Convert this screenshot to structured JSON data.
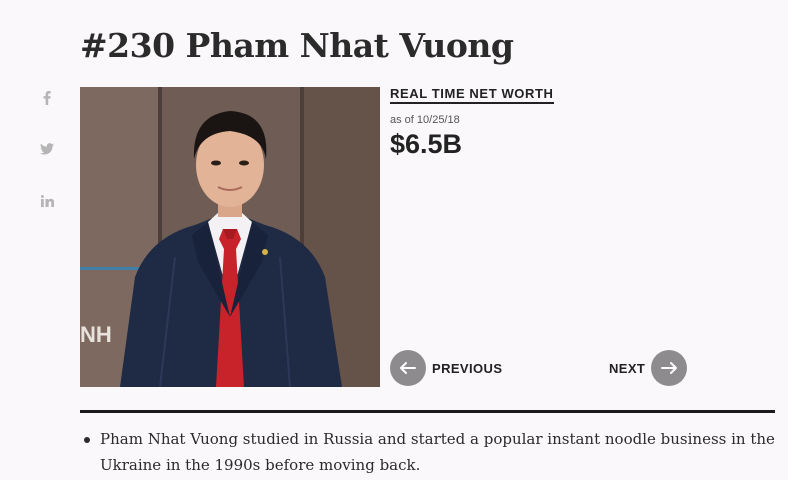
{
  "profile": {
    "title": "#230 Pham Nhat Vuong",
    "photo_alt": "Pham Nhat Vuong",
    "photo_sign_text": "NH"
  },
  "social": [
    {
      "network": "facebook",
      "icon": "facebook-icon"
    },
    {
      "network": "twitter",
      "icon": "twitter-icon"
    },
    {
      "network": "linkedin",
      "icon": "linkedin-icon"
    }
  ],
  "net_worth": {
    "label": "REAL TIME NET WORTH",
    "as_of": "as of 10/25/18",
    "value": "$6.5B"
  },
  "navigation": {
    "previous_label": "PREVIOUS",
    "next_label": "NEXT"
  },
  "bullets": [
    "Pham Nhat Vuong studied in Russia and started a popular instant noodle business in the Ukraine in the 1990s before moving back."
  ],
  "colors": {
    "background": "#faf8fb",
    "text": "#222222",
    "nav_circle": "#8e8b8e",
    "social_icon": "#b5b5b5",
    "divider": "#1b1b1b"
  }
}
